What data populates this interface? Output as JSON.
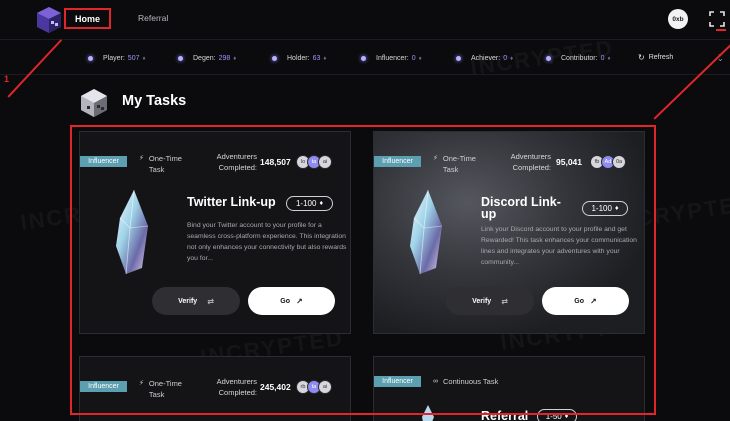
{
  "nav": {
    "home_label": "Home",
    "referral_label": "Referral",
    "avatar_text": "0xb"
  },
  "stats": [
    {
      "label": "Player:",
      "value": "507"
    },
    {
      "label": "Degen:",
      "value": "298"
    },
    {
      "label": "Holder:",
      "value": "63"
    },
    {
      "label": "Influencer:",
      "value": "0"
    },
    {
      "label": "Achiever:",
      "value": "0"
    },
    {
      "label": "Contributor:",
      "value": "0"
    }
  ],
  "refresh_label": "Refresh",
  "page_title": "My Tasks",
  "annotation_number": "1",
  "watermark": "INCRYPTED",
  "cards": [
    {
      "badge": "Influencer",
      "task_type": "One-Time Task",
      "adv_label": "Adventurers Completed:",
      "adv_count": "148,507",
      "avatars": [
        "lo",
        "ta",
        "ai"
      ],
      "title": "Twitter Link-up",
      "reward": "1-100",
      "description": "Bind your Twitter account to your profile for a seamless cross-platform experience. This integration not only enhances your connectivity but also rewards you for...",
      "verify_label": "Verify",
      "go_label": "Go"
    },
    {
      "badge": "Influencer",
      "task_type": "One-Time Task",
      "adv_label": "Adventurers Completed:",
      "adv_count": "95,041",
      "avatars": [
        "fb",
        "Ad",
        "0a"
      ],
      "title": "Discord Link-up",
      "reward": "1-100",
      "description": "Link your Discord account to your profile and get Rewarded! This task enhances your communication lines and integrates your adventures with your community...",
      "verify_label": "Verify",
      "go_label": "Go"
    },
    {
      "badge": "Influencer",
      "task_type": "One-Time Task",
      "adv_label": "Adventurers Completed:",
      "adv_count": "245,402",
      "avatars": [
        "rb",
        "ta",
        "ai"
      ]
    },
    {
      "badge": "Influencer",
      "task_type": "Continuous Task",
      "title": "Referral",
      "reward": "1-50"
    }
  ],
  "colors": {
    "accent": "#9c96ff",
    "badge": "#5b9fb0",
    "annotation": "#e0262a"
  }
}
